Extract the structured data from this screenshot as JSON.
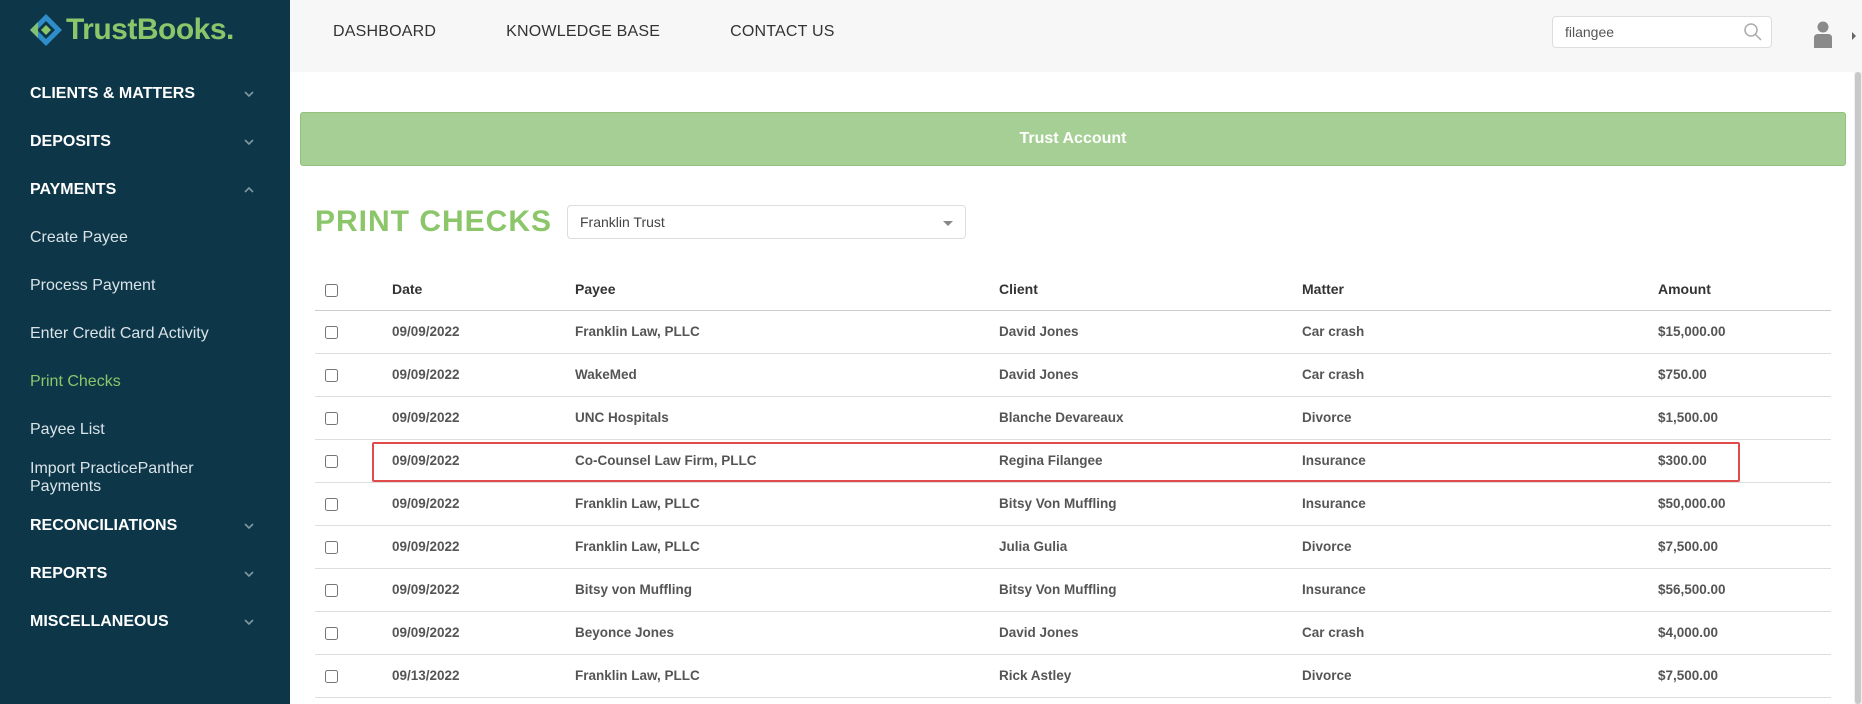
{
  "brand": {
    "name": "TrustBooks",
    "dot": "."
  },
  "sidebar": {
    "items": [
      {
        "label": "CLIENTS & MATTERS",
        "type": "section",
        "expanded": false
      },
      {
        "label": "DEPOSITS",
        "type": "section",
        "expanded": false
      },
      {
        "label": "PAYMENTS",
        "type": "section",
        "expanded": true
      },
      {
        "label": "Create Payee",
        "type": "sub"
      },
      {
        "label": "Process Payment",
        "type": "sub"
      },
      {
        "label": "Enter Credit Card Activity",
        "type": "sub"
      },
      {
        "label": "Print Checks",
        "type": "sub",
        "active": true
      },
      {
        "label": "Payee List",
        "type": "sub"
      },
      {
        "label": "Import PracticePanther Payments",
        "type": "sub"
      },
      {
        "label": "RECONCILIATIONS",
        "type": "section",
        "expanded": false
      },
      {
        "label": "REPORTS",
        "type": "section",
        "expanded": false
      },
      {
        "label": "MISCELLANEOUS",
        "type": "section",
        "expanded": false
      }
    ]
  },
  "header": {
    "nav": [
      "DASHBOARD",
      "KNOWLEDGE BASE",
      "CONTACT US"
    ],
    "search_value": "filangee",
    "search_icon": "search-icon",
    "user_icon": "user-icon"
  },
  "banner": {
    "label": "Trust Account"
  },
  "page": {
    "title": "PRINT CHECKS",
    "account_select": "Franklin Trust"
  },
  "table": {
    "headers": [
      "Date",
      "Payee",
      "Client",
      "Matter",
      "Amount"
    ],
    "rows": [
      {
        "date": "09/09/2022",
        "payee": "Franklin Law, PLLC",
        "client": "David Jones",
        "matter": "Car crash",
        "amount": "$15,000.00"
      },
      {
        "date": "09/09/2022",
        "payee": "WakeMed",
        "client": "David Jones",
        "matter": "Car crash",
        "amount": "$750.00"
      },
      {
        "date": "09/09/2022",
        "payee": "UNC Hospitals",
        "client": "Blanche Devareaux",
        "matter": "Divorce",
        "amount": "$1,500.00"
      },
      {
        "date": "09/09/2022",
        "payee": "Co-Counsel Law Firm, PLLC",
        "client": "Regina Filangee",
        "matter": "Insurance",
        "amount": "$300.00",
        "highlighted": true
      },
      {
        "date": "09/09/2022",
        "payee": "Franklin Law, PLLC",
        "client": "Bitsy Von Muffling",
        "matter": "Insurance",
        "amount": "$50,000.00"
      },
      {
        "date": "09/09/2022",
        "payee": "Franklin Law, PLLC",
        "client": "Julia Gulia",
        "matter": "Divorce",
        "amount": "$7,500.00"
      },
      {
        "date": "09/09/2022",
        "payee": "Bitsy von Muffling",
        "client": "Bitsy Von Muffling",
        "matter": "Insurance",
        "amount": "$56,500.00"
      },
      {
        "date": "09/09/2022",
        "payee": "Beyonce Jones",
        "client": "David Jones",
        "matter": "Car crash",
        "amount": "$4,000.00"
      },
      {
        "date": "09/13/2022",
        "payee": "Franklin Law, PLLC",
        "client": "Rick Astley",
        "matter": "Divorce",
        "amount": "$7,500.00"
      }
    ]
  },
  "colors": {
    "sidebar_bg": "#0d3648",
    "brand_green": "#8cc66a",
    "banner_green": "#a5cf94",
    "highlight_red": "#e04c4c"
  }
}
